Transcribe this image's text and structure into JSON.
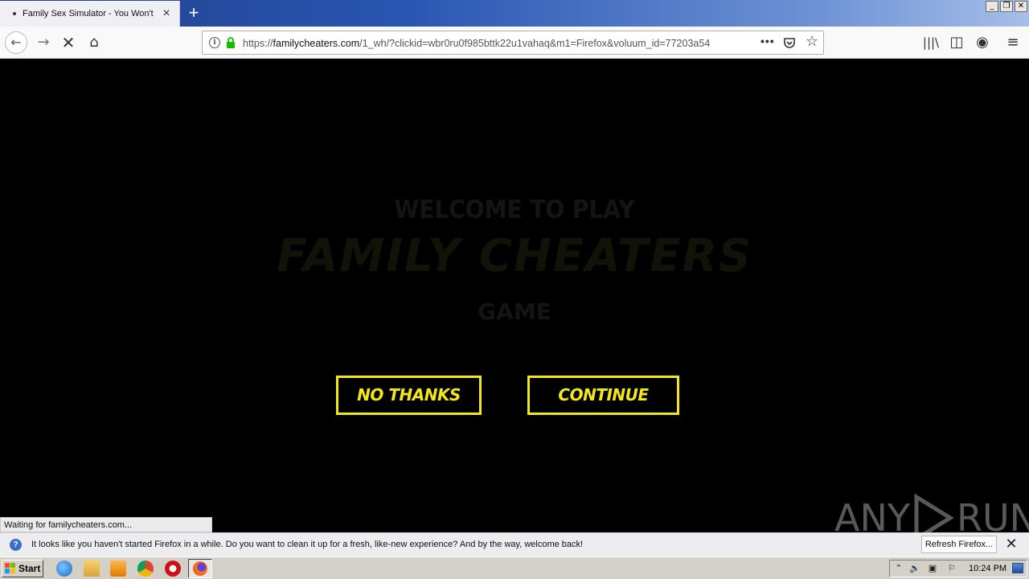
{
  "browser": {
    "tab_title": "Family Sex Simulator - You Won't L",
    "tab_close": "×",
    "new_tab": "+",
    "url_prefix": "https://",
    "url_host": "familycheaters.com",
    "url_path": "/1_wh/?clickid=wbr0ru0f985bttk22u1vahaq&m1=Firefox&voluum_id=77203a54",
    "page_actions": "•••",
    "star": "☆",
    "stop": "✕",
    "back": "←",
    "forward": "→",
    "home": "⌂",
    "library": "|||\\",
    "sidebar": "◫",
    "account": "◉",
    "menu": "≡",
    "window_controls": [
      "_",
      "❐",
      "✕"
    ]
  },
  "page": {
    "welcome": "WELCOME TO PLAY",
    "logo": "FAMILY CHEATERS",
    "game": "GAME",
    "no_thanks": "NO THANKS",
    "continue": "CONTINUE",
    "watermark_left": "ANY",
    "watermark_right": "RUN"
  },
  "status": {
    "text": "Waiting for familycheaters.com..."
  },
  "notification": {
    "icon": "?",
    "message": "It looks like you haven't started Firefox in a while. Do you want to clean it up for a fresh, like-new experience? And by the way, welcome back!",
    "refresh_label": "Refresh Firefox...",
    "close": "✕"
  },
  "taskbar": {
    "start": "Start",
    "tray_arrow": "⌃",
    "tray_volume": "🔈",
    "tray_network": "▣",
    "tray_flag": "⚐",
    "clock": "10:24 PM"
  },
  "colors": {
    "accent_yellow": "#f2e818",
    "page_background": "#000000",
    "titlebar_blue": "#2a56b2"
  }
}
